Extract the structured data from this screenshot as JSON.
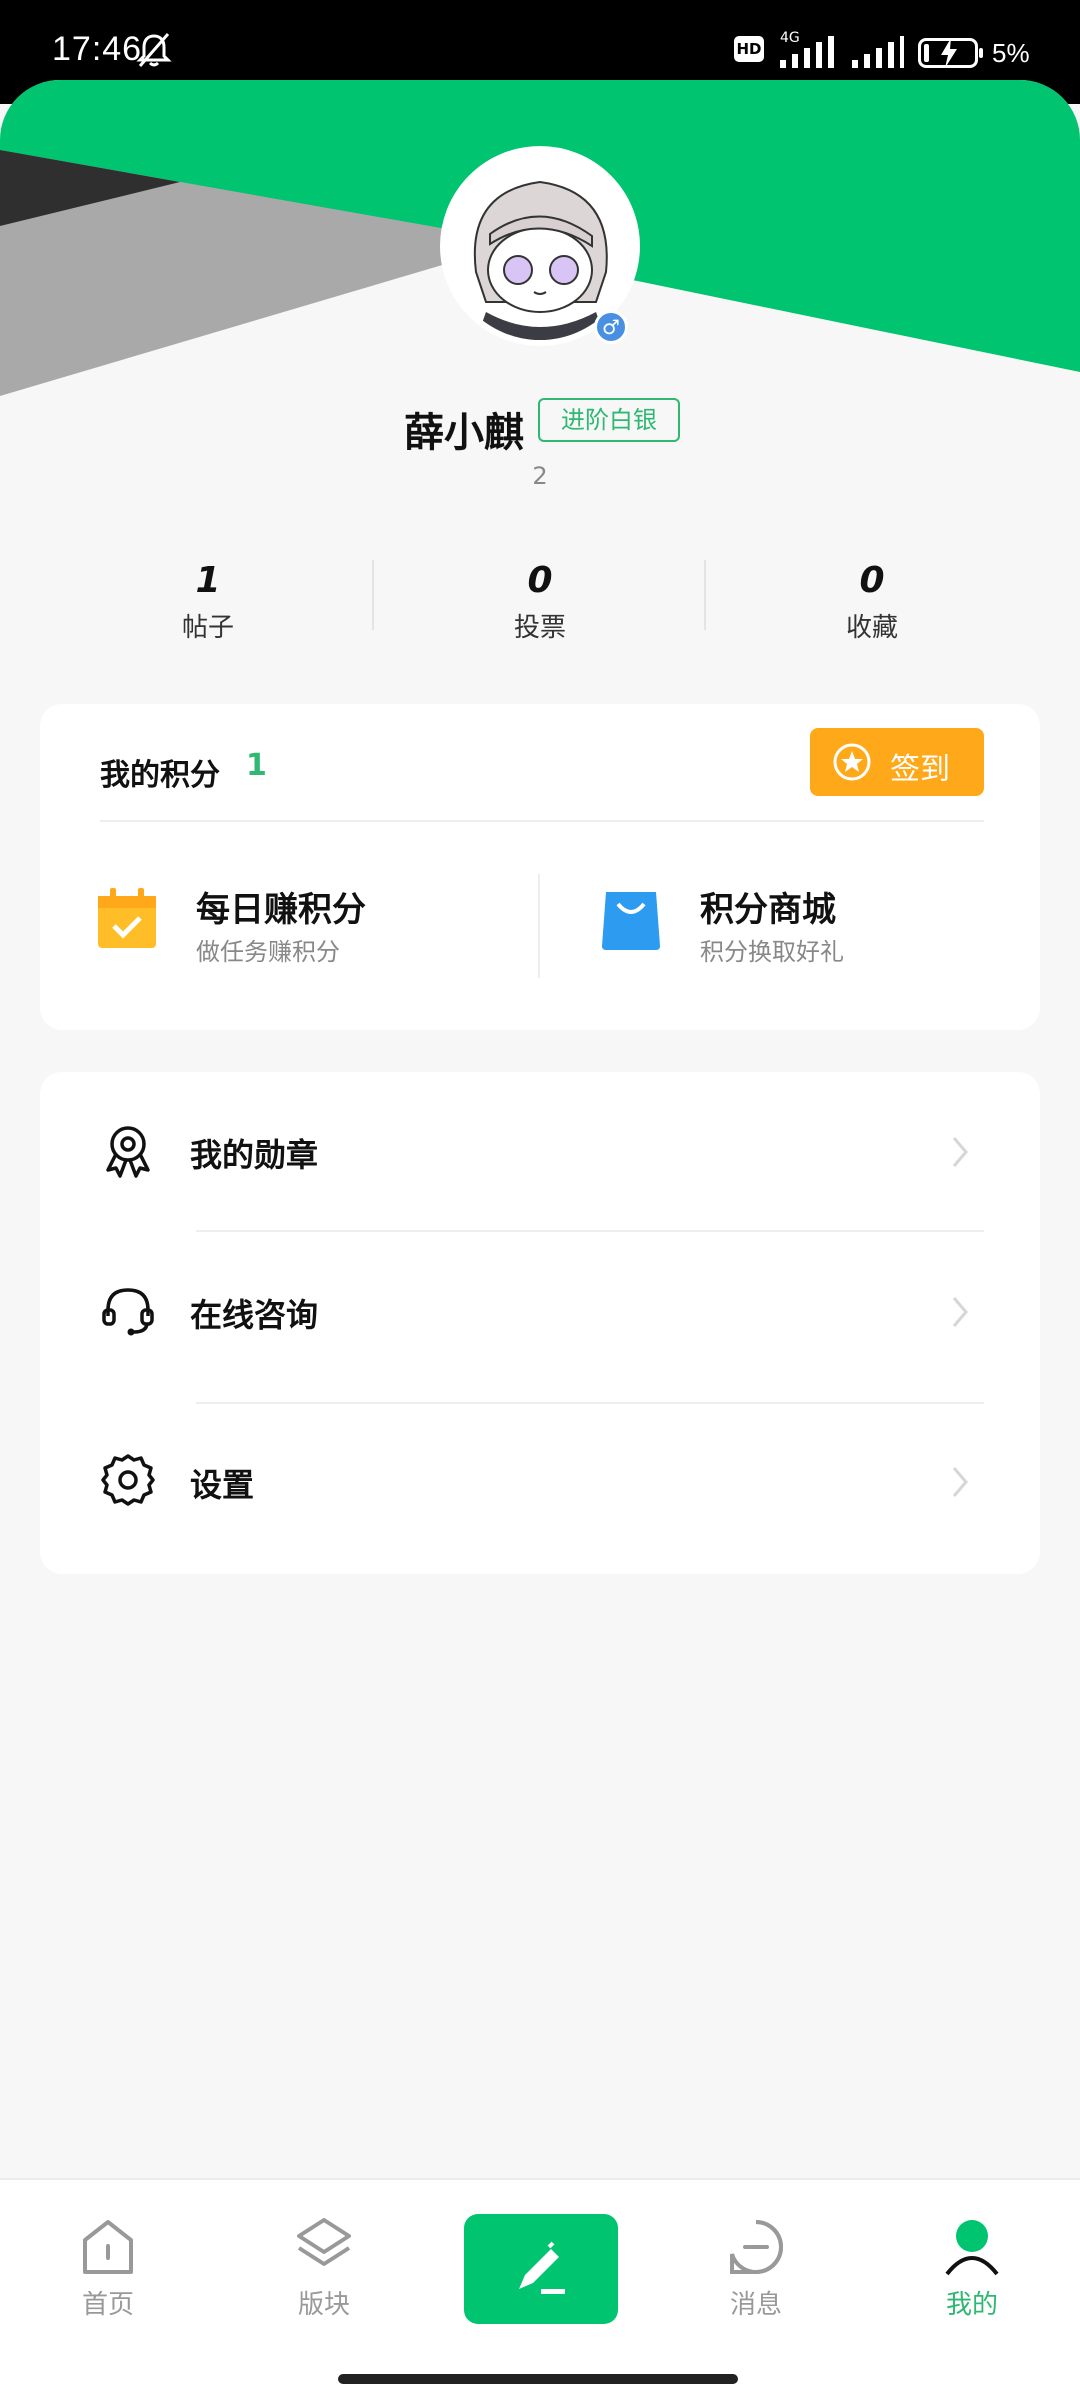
{
  "status_bar": {
    "time": "17:46",
    "network": "4G",
    "hd": "HD",
    "battery_percent": "5%",
    "battery_level": 0.05
  },
  "profile": {
    "username": "薛小麒",
    "level_badge": "进阶白银",
    "user_id": "2",
    "gender_symbol": "♂",
    "header_colors": {
      "green": "#00c46f",
      "gray": "#a8a9a8",
      "dark": "#2f2f2f"
    }
  },
  "stats": [
    {
      "value": "1",
      "label": "帖子"
    },
    {
      "value": "0",
      "label": "投票"
    },
    {
      "value": "0",
      "label": "收藏"
    }
  ],
  "points": {
    "title": "我的积分",
    "value": "1",
    "checkin_label": "签到",
    "features": [
      {
        "title": "每日赚积分",
        "subtitle": "做任务赚积分"
      },
      {
        "title": "积分商城",
        "subtitle": "积分换取好礼"
      }
    ]
  },
  "menu": [
    {
      "label": "我的勋章",
      "icon": "medal-icon"
    },
    {
      "label": "在线咨询",
      "icon": "headset-icon"
    },
    {
      "label": "设置",
      "icon": "gear-icon"
    }
  ],
  "bottom_nav": [
    {
      "label": "首页",
      "icon": "home-icon"
    },
    {
      "label": "版块",
      "icon": "layers-icon"
    },
    {
      "label": "消息",
      "icon": "message-icon"
    },
    {
      "label": "我的",
      "icon": "profile-icon",
      "active": true
    }
  ],
  "colors": {
    "accent": "#00c46f",
    "active_text": "#2eb872",
    "checkin": "#ffa91a"
  }
}
